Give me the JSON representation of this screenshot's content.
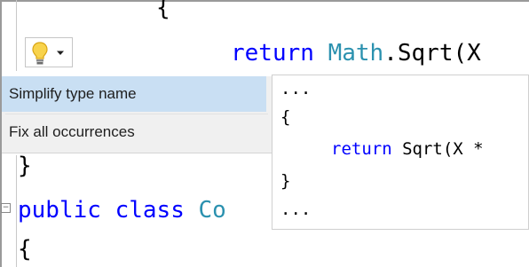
{
  "editor": {
    "line1": "{",
    "line2_keyword": "return",
    "line2_space": " ",
    "line2_type": "Math",
    "line2_rest": ".Sqrt(X",
    "line_close": "}",
    "line_public": "public",
    "line_class": "class",
    "line_class_name": "Co",
    "line_open": "{"
  },
  "lightbulb": {
    "icon": "lightbulb-icon",
    "caret_icon": "chevron-down-icon"
  },
  "quick_actions": {
    "items": [
      {
        "label": "Simplify type name",
        "selected": true
      },
      {
        "label": "Fix all occurrences",
        "selected": false
      }
    ]
  },
  "preview": {
    "line1": "...",
    "line2": "{",
    "line3_keyword": "return",
    "line3_rest": " Sqrt(X *",
    "line4": "}",
    "line5": "..."
  },
  "colors": {
    "keyword": "#0000ff",
    "type": "#2b91af",
    "selection": "#c9dff3",
    "menu_bg": "#f0f0f0"
  }
}
